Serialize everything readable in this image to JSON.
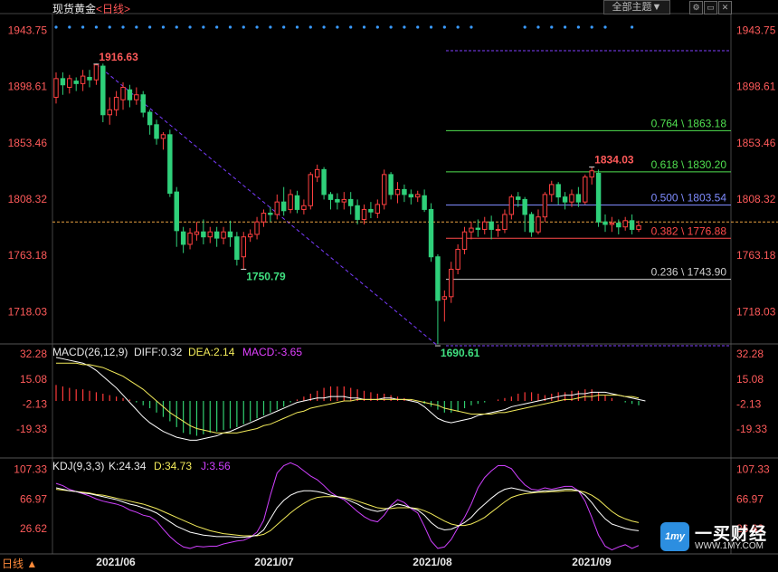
{
  "instrument": {
    "name": "现货黄金",
    "period": "<日线>"
  },
  "toolbar": {
    "theme_select": "全部主题▼"
  },
  "main_axis": {
    "ticks": [
      "1943.75",
      "1898.61",
      "1853.46",
      "1808.32",
      "1763.18",
      "1718.03"
    ]
  },
  "price_labels": {
    "high1": "1916.63",
    "low1": "1750.79",
    "high2": "1834.03",
    "low2": "1690.61"
  },
  "fibonacci": [
    {
      "label": "0.764 \\ 1863.18",
      "price": 1863.18,
      "color": "#50e050"
    },
    {
      "label": "0.618 \\ 1830.20",
      "price": 1830.2,
      "color": "#50e050"
    },
    {
      "label": "0.500 \\ 1803.54",
      "price": 1803.54,
      "color": "#7f8cff"
    },
    {
      "label": "0.382 \\ 1776.88",
      "price": 1776.88,
      "color": "#ff4a4a"
    },
    {
      "label": "0.236 \\ 1743.90",
      "price": 1743.9,
      "color": "#cfcfcf"
    }
  ],
  "macd": {
    "title": "MACD(26,12,9)",
    "diff": "DIFF:0.32",
    "dea": "DEA:2.14",
    "macd": "MACD:-3.65",
    "ticks": [
      "32.28",
      "15.08",
      "-2.13",
      "-19.33"
    ]
  },
  "kdj": {
    "title": "KDJ(9,3,3)",
    "k": "K:24.34",
    "d": "D:34.73",
    "j": "J:3.56",
    "ticks": [
      "107.33",
      "66.97",
      "26.62"
    ]
  },
  "x_axis": {
    "labels": [
      "2021/06",
      "2021/07",
      "2021/08",
      "2021/09"
    ]
  },
  "bottom_tab": "日线 ▲",
  "logo": {
    "mark": "1my",
    "name": "一买财经",
    "url": "WWW.1MY.COM"
  },
  "chart_data": {
    "type": "candlestick",
    "title": "现货黄金",
    "period": "日线",
    "x_labels": [
      "2021/06",
      "2021/07",
      "2021/08",
      "2021/09"
    ],
    "ylim": [
      1695,
      1955
    ],
    "current_price_line": 1790,
    "candles": [
      [
        1890,
        1905,
        1885,
        1910
      ],
      [
        1905,
        1900,
        1892,
        1910
      ],
      [
        1898,
        1905,
        1893,
        1908
      ],
      [
        1903,
        1901,
        1895,
        1906
      ],
      [
        1901,
        1907,
        1895,
        1912
      ],
      [
        1906,
        1904,
        1898,
        1912
      ],
      [
        1904,
        1916,
        1900,
        1917
      ],
      [
        1915,
        1876,
        1870,
        1917
      ],
      [
        1876,
        1880,
        1868,
        1890
      ],
      [
        1880,
        1890,
        1875,
        1895
      ],
      [
        1888,
        1898,
        1880,
        1902
      ],
      [
        1896,
        1888,
        1882,
        1900
      ],
      [
        1888,
        1892,
        1884,
        1898
      ],
      [
        1892,
        1878,
        1874,
        1895
      ],
      [
        1878,
        1868,
        1860,
        1880
      ],
      [
        1868,
        1857,
        1852,
        1872
      ],
      [
        1857,
        1860,
        1848,
        1862
      ],
      [
        1860,
        1813,
        1810,
        1864
      ],
      [
        1814,
        1783,
        1770,
        1818
      ],
      [
        1782,
        1772,
        1765,
        1786
      ],
      [
        1772,
        1781,
        1768,
        1785
      ],
      [
        1780,
        1782,
        1775,
        1790
      ],
      [
        1782,
        1778,
        1772,
        1792
      ],
      [
        1778,
        1782,
        1773,
        1786
      ],
      [
        1782,
        1777,
        1770,
        1786
      ],
      [
        1777,
        1782,
        1772,
        1786
      ],
      [
        1782,
        1778,
        1770,
        1791
      ],
      [
        1778,
        1760,
        1755,
        1782
      ],
      [
        1762,
        1778,
        1752,
        1782
      ],
      [
        1778,
        1780,
        1774,
        1784
      ],
      [
        1780,
        1790,
        1776,
        1794
      ],
      [
        1790,
        1797,
        1786,
        1800
      ],
      [
        1797,
        1796,
        1790,
        1802
      ],
      [
        1796,
        1806,
        1792,
        1812
      ],
      [
        1806,
        1799,
        1795,
        1818
      ],
      [
        1800,
        1812,
        1797,
        1816
      ],
      [
        1811,
        1800,
        1797,
        1815
      ],
      [
        1800,
        1803,
        1796,
        1808
      ],
      [
        1803,
        1828,
        1800,
        1830
      ],
      [
        1826,
        1832,
        1822,
        1836
      ],
      [
        1832,
        1812,
        1808,
        1834
      ],
      [
        1812,
        1808,
        1800,
        1814
      ],
      [
        1808,
        1806,
        1800,
        1813
      ],
      [
        1806,
        1808,
        1800,
        1814
      ],
      [
        1808,
        1803,
        1796,
        1814
      ],
      [
        1803,
        1792,
        1788,
        1808
      ],
      [
        1792,
        1800,
        1788,
        1804
      ],
      [
        1800,
        1798,
        1793,
        1806
      ],
      [
        1797,
        1804,
        1793,
        1808
      ],
      [
        1804,
        1828,
        1800,
        1832
      ],
      [
        1828,
        1812,
        1808,
        1830
      ],
      [
        1812,
        1816,
        1805,
        1822
      ],
      [
        1816,
        1812,
        1806,
        1820
      ],
      [
        1812,
        1810,
        1804,
        1816
      ],
      [
        1810,
        1812,
        1806,
        1815
      ],
      [
        1811,
        1800,
        1798,
        1816
      ],
      [
        1800,
        1762,
        1758,
        1805
      ],
      [
        1762,
        1727,
        1692,
        1764
      ],
      [
        1728,
        1730,
        1710,
        1735
      ],
      [
        1730,
        1752,
        1725,
        1758
      ],
      [
        1752,
        1768,
        1748,
        1772
      ],
      [
        1768,
        1782,
        1764,
        1786
      ],
      [
        1782,
        1785,
        1776,
        1790
      ],
      [
        1785,
        1784,
        1778,
        1792
      ],
      [
        1784,
        1790,
        1780,
        1794
      ],
      [
        1790,
        1784,
        1776,
        1795
      ],
      [
        1784,
        1784,
        1778,
        1788
      ],
      [
        1784,
        1796,
        1781,
        1800
      ],
      [
        1796,
        1810,
        1792,
        1812
      ],
      [
        1810,
        1808,
        1802,
        1814
      ],
      [
        1808,
        1796,
        1782,
        1810
      ],
      [
        1796,
        1782,
        1778,
        1798
      ],
      [
        1782,
        1794,
        1780,
        1800
      ],
      [
        1794,
        1812,
        1790,
        1814
      ],
      [
        1812,
        1820,
        1806,
        1823
      ],
      [
        1820,
        1810,
        1804,
        1822
      ],
      [
        1810,
        1806,
        1800,
        1814
      ],
      [
        1806,
        1812,
        1802,
        1816
      ],
      [
        1812,
        1806,
        1802,
        1818
      ],
      [
        1806,
        1826,
        1804,
        1828
      ],
      [
        1826,
        1831,
        1820,
        1834
      ],
      [
        1829,
        1790,
        1786,
        1832
      ],
      [
        1790,
        1788,
        1782,
        1796
      ],
      [
        1788,
        1789,
        1782,
        1794
      ],
      [
        1789,
        1786,
        1780,
        1792
      ],
      [
        1786,
        1791,
        1783,
        1794
      ],
      [
        1791,
        1784,
        1780,
        1796
      ],
      [
        1784,
        1787,
        1782,
        1791
      ]
    ],
    "macd_ylim": [
      -38,
      38
    ],
    "macd_hist": [
      11,
      10,
      9,
      8,
      8,
      7,
      6,
      5,
      4,
      3,
      2,
      1,
      -1,
      -3,
      -5,
      -8,
      -11,
      -14,
      -18,
      -22,
      -23,
      -24,
      -23,
      -22,
      -21,
      -20,
      -19,
      -18,
      -16,
      -14,
      -12,
      -10,
      -8,
      -6,
      -4,
      -1,
      1,
      3,
      5,
      7,
      9,
      10,
      10,
      10,
      9,
      8,
      7,
      6,
      5,
      5,
      4,
      3,
      2,
      1,
      0,
      -2,
      -4,
      -6,
      -8,
      -8,
      -7,
      -5,
      -3,
      -2,
      -1,
      0,
      1,
      2,
      3,
      5,
      6,
      6,
      5,
      4,
      5,
      6,
      6,
      7,
      7,
      8,
      8,
      6,
      4,
      2,
      0,
      -1,
      -2,
      -3
    ],
    "macd_diff": [
      30,
      29,
      28,
      27,
      26,
      24,
      21,
      17,
      13,
      9,
      4,
      -1,
      -6,
      -11,
      -15,
      -18,
      -21,
      -23,
      -25,
      -26,
      -27,
      -27,
      -26,
      -25,
      -24,
      -22,
      -21,
      -19,
      -17,
      -15,
      -13,
      -11,
      -9,
      -7,
      -5,
      -3,
      -1,
      0,
      1,
      2,
      2,
      3,
      3,
      3,
      2,
      2,
      1,
      1,
      1,
      2,
      2,
      1,
      1,
      0,
      -1,
      -4,
      -8,
      -12,
      -14,
      -15,
      -14,
      -13,
      -12,
      -10,
      -9,
      -8,
      -7,
      -6,
      -4,
      -3,
      -2,
      -1,
      0,
      1,
      2,
      3,
      4,
      4,
      5,
      5,
      6,
      6,
      6,
      5,
      4,
      3,
      2,
      1,
      0
    ],
    "macd_dea": [
      26,
      26,
      26,
      26,
      25,
      25,
      24,
      23,
      21,
      19,
      17,
      14,
      11,
      8,
      4,
      0,
      -4,
      -8,
      -11,
      -14,
      -17,
      -19,
      -20,
      -21,
      -22,
      -22,
      -22,
      -22,
      -21,
      -20,
      -19,
      -17,
      -16,
      -14,
      -12,
      -10,
      -8,
      -7,
      -5,
      -4,
      -3,
      -2,
      -1,
      0,
      0,
      1,
      1,
      1,
      1,
      1,
      1,
      1,
      1,
      1,
      0,
      -1,
      -2,
      -3,
      -5,
      -6,
      -7,
      -8,
      -9,
      -9,
      -9,
      -9,
      -8,
      -8,
      -7,
      -6,
      -5,
      -4,
      -3,
      -2,
      -1,
      0,
      1,
      1,
      2,
      3,
      3,
      4,
      4,
      4,
      4,
      3,
      3,
      2
    ],
    "kdj_ylim": [
      -5,
      120
    ],
    "kdj_k": [
      82,
      80,
      78,
      77,
      75,
      74,
      72,
      70,
      68,
      66,
      63,
      60,
      58,
      55,
      52,
      48,
      42,
      36,
      30,
      26,
      22,
      20,
      18,
      17,
      16,
      16,
      16,
      15,
      15,
      16,
      18,
      25,
      40,
      55,
      65,
      72,
      76,
      78,
      78,
      77,
      75,
      72,
      70,
      68,
      64,
      60,
      55,
      52,
      50,
      52,
      56,
      60,
      58,
      55,
      52,
      45,
      35,
      28,
      25,
      26,
      30,
      35,
      42,
      52,
      60,
      68,
      75,
      80,
      82,
      80,
      78,
      76,
      77,
      78,
      78,
      79,
      80,
      80,
      78,
      72,
      62,
      50,
      40,
      33,
      30,
      27,
      25,
      24
    ],
    "kdj_d": [
      80,
      79,
      78,
      77,
      76,
      75,
      73,
      72,
      70,
      68,
      66,
      64,
      62,
      60,
      57,
      54,
      50,
      46,
      42,
      38,
      34,
      30,
      27,
      24,
      22,
      20,
      19,
      18,
      17,
      17,
      17,
      19,
      24,
      32,
      40,
      48,
      55,
      61,
      66,
      69,
      70,
      70,
      70,
      69,
      67,
      64,
      61,
      58,
      55,
      54,
      54,
      55,
      55,
      55,
      54,
      51,
      47,
      42,
      37,
      33,
      31,
      31,
      33,
      37,
      42,
      49,
      56,
      63,
      69,
      72,
      74,
      75,
      76,
      76,
      77,
      77,
      78,
      78,
      78,
      76,
      72,
      66,
      58,
      50,
      44,
      40,
      37,
      35
    ],
    "kdj_j": [
      88,
      85,
      80,
      77,
      74,
      71,
      67,
      64,
      62,
      60,
      57,
      52,
      49,
      45,
      43,
      37,
      26,
      16,
      8,
      2,
      0,
      3,
      2,
      3,
      3,
      6,
      8,
      10,
      11,
      15,
      22,
      38,
      72,
      102,
      112,
      116,
      112,
      105,
      98,
      93,
      85,
      76,
      70,
      66,
      58,
      50,
      43,
      38,
      36,
      45,
      58,
      66,
      62,
      54,
      48,
      30,
      10,
      0,
      2,
      12,
      28,
      42,
      60,
      82,
      96,
      105,
      112,
      112,
      108,
      96,
      86,
      80,
      79,
      82,
      80,
      82,
      84,
      84,
      78,
      64,
      42,
      18,
      3,
      -2,
      2,
      5,
      0,
      4
    ]
  }
}
